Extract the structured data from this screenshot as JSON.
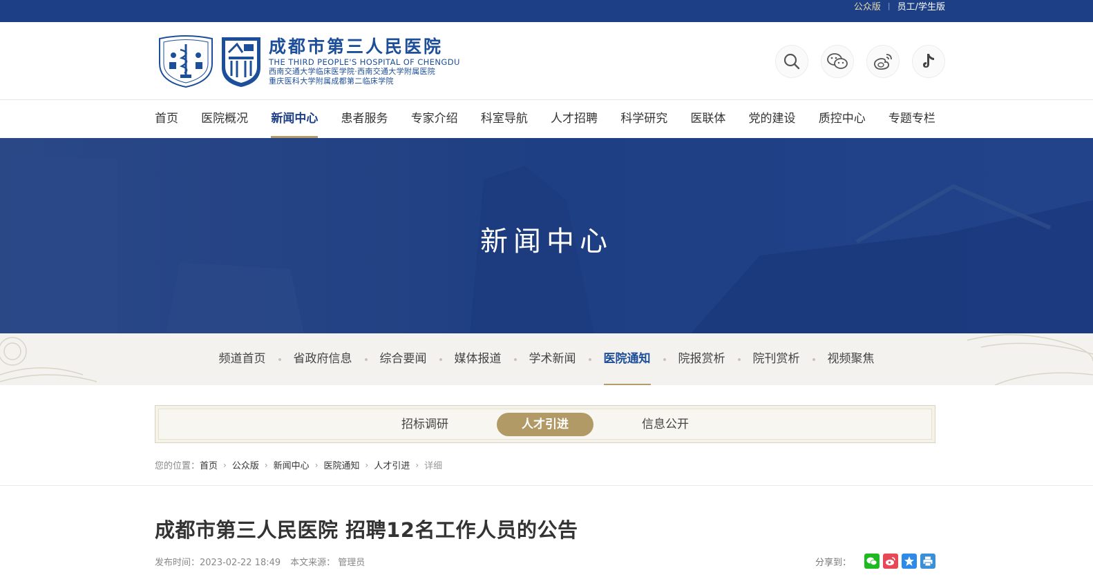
{
  "topbar": {
    "public_label": "公众版",
    "staff_label": "员工/学生版"
  },
  "logo": {
    "name_cn": "成都市第三人民医院",
    "name_en": "THE THIRD PEOPLE'S HOSPITAL OF CHENGDU",
    "sub1": "西南交通大学临床医学院·西南交通大学附属医院",
    "sub2": "重庆医科大学附属成都第二临床学院"
  },
  "header_icons": [
    "search-icon",
    "wechat-icon",
    "weibo-icon",
    "tiktok-icon"
  ],
  "nav": {
    "items": [
      "首页",
      "医院概况",
      "新闻中心",
      "患者服务",
      "专家介绍",
      "科室导航",
      "人才招聘",
      "科学研究",
      "医联体",
      "党的建设",
      "质控中心",
      "专题专栏"
    ],
    "active_index": 2
  },
  "banner": {
    "title": "新闻中心"
  },
  "subnav": {
    "items": [
      "频道首页",
      "省政府信息",
      "综合要闻",
      "媒体报道",
      "学术新闻",
      "医院通知",
      "院报赏析",
      "院刊赏析",
      "视频聚焦"
    ],
    "active_index": 5
  },
  "tabs": {
    "items": [
      "招标调研",
      "人才引进",
      "信息公开"
    ],
    "active_index": 1
  },
  "breadcrumb": {
    "prefix": "您的位置：",
    "items": [
      "首页",
      "公众版",
      "新闻中心",
      "医院通知",
      "人才引进"
    ],
    "current": "详细"
  },
  "article": {
    "title": "成都市第三人民医院 招聘12名工作人员的公告",
    "publish_time": "发布时间：2023-02-22 18:49",
    "source": "本文来源：  管理员",
    "share_label": "分享到："
  },
  "colors": {
    "primary": "#1c3f86",
    "accent_gold": "#b39b6c",
    "logo_blue": "#1c4e9a"
  }
}
